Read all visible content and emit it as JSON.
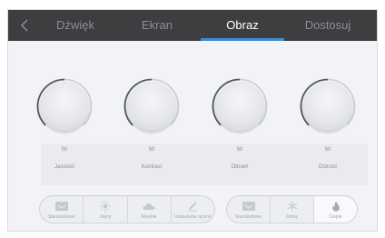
{
  "tabs": [
    {
      "label": "Dźwięk",
      "active": false
    },
    {
      "label": "Ekran",
      "active": false
    },
    {
      "label": "Obraz",
      "active": true
    },
    {
      "label": "Dostosuj",
      "active": false
    }
  ],
  "colors": {
    "accent": "#2f8ee8",
    "topbar": "#3d3e40"
  },
  "knobs": [
    {
      "label": "Jasność",
      "value": "50",
      "level": 0.5
    },
    {
      "label": "Kontrast",
      "value": "50",
      "level": 0.5
    },
    {
      "label": "Odcień",
      "value": "50",
      "level": 0.5
    },
    {
      "label": "Ostrość",
      "value": "50",
      "level": 0.5
    }
  ],
  "picture_modes": [
    {
      "label": "Standardowe",
      "icon": "monitor-icon"
    },
    {
      "label": "Jasny",
      "icon": "sun-icon"
    },
    {
      "label": "Miękkie",
      "icon": "cloud-icon"
    },
    {
      "label": "Ustawienia ręczne",
      "icon": "pencil-icon"
    }
  ],
  "color_temps": [
    {
      "label": "Standardowe",
      "icon": "monitor-icon"
    },
    {
      "label": "Zimny",
      "icon": "snowflake-icon"
    },
    {
      "label": "Ciepłe",
      "icon": "flame-icon",
      "selected": true
    }
  ]
}
